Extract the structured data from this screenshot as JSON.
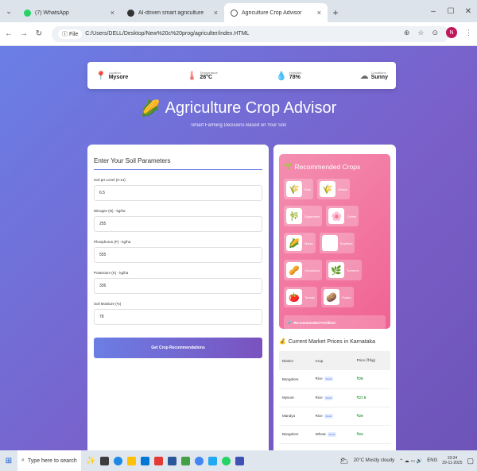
{
  "browser": {
    "tabs": [
      {
        "label": "(7) WhatsApp",
        "icon": "whatsapp-icon",
        "color": "#25d366"
      },
      {
        "label": "AI-driven smart agriculture",
        "icon": "ai-icon",
        "color": "#333333"
      },
      {
        "label": "Agriculture Crop Advisor",
        "icon": "globe-icon",
        "color": "#555555",
        "active": true
      }
    ],
    "new_tab": "+",
    "file_chip": "File",
    "address": "C:/Users/DELL/Desktop/New%20c%20prog/agriculter/index.HTML",
    "profile_initial": "N"
  },
  "weather": {
    "location": {
      "caption": "Location",
      "value": "Mysore"
    },
    "temperature": {
      "caption": "Temperature",
      "value": "28°C"
    },
    "humidity": {
      "caption": "Humidity",
      "value": "78%"
    },
    "conditions": {
      "caption": "Conditions",
      "value": "Sunny"
    }
  },
  "hero": {
    "title": "Agriculture Crop Advisor",
    "subtitle": "Smart Farming Decisions Based on Your Soil"
  },
  "soil_form": {
    "heading": "Enter Your Soil Parameters",
    "fields": [
      {
        "label": "Soil pH Level (0-14)",
        "value": "6.5"
      },
      {
        "label": "Nitrogen (N) - kg/ha",
        "value": "255"
      },
      {
        "label": "Phosphorus (P) - kg/ha",
        "value": "555"
      },
      {
        "label": "Potassium (K) - kg/ha",
        "value": "336"
      },
      {
        "label": "Soil Moisture (%)",
        "value": "78"
      }
    ],
    "submit_label": "Get Crop Recommendations"
  },
  "recommendations": {
    "heading": "Recommended Crops",
    "crops": [
      {
        "name": "Rice",
        "glyph": "🌾"
      },
      {
        "name": "Wheat",
        "glyph": "🌾"
      },
      {
        "name": "Sugarcane",
        "glyph": "🎋"
      },
      {
        "name": "Cotton",
        "glyph": "🌸"
      },
      {
        "name": "Maize",
        "glyph": "🌽"
      },
      {
        "name": "Soybean",
        "glyph": ""
      },
      {
        "name": "Groundnut",
        "glyph": "🥜"
      },
      {
        "name": "Turmeric",
        "glyph": "🌿"
      },
      {
        "name": "Tomato",
        "glyph": "🍅"
      },
      {
        "name": "Potato",
        "glyph": "🥔"
      }
    ],
    "fertilizer_title": "Recommended Fertilizer:",
    "fertilizer_desc": "NPK Complex (19-19-19) for balanced nutrition"
  },
  "market": {
    "heading": "Current Market Prices in Karnataka",
    "columns": [
      "District",
      "Crop",
      "Price (₹/kg)"
    ],
    "rows": [
      {
        "district": "Bangalore",
        "crop": "Rice",
        "badge": "Fresh",
        "price": "₹28"
      },
      {
        "district": "Mysore",
        "crop": "Rice",
        "badge": "Fresh",
        "price": "₹27.5"
      },
      {
        "district": "Mandya",
        "crop": "Rice",
        "badge": "Fresh",
        "price": "₹29"
      },
      {
        "district": "Bangalore",
        "crop": "Wheat",
        "badge": "Fresh",
        "price": "₹24"
      }
    ]
  },
  "taskbar": {
    "search_placeholder": "Type here to search",
    "weather": "20°C Mostly cloudy",
    "lang": "ENG",
    "time": "19:34",
    "date": "29-11-2025"
  }
}
